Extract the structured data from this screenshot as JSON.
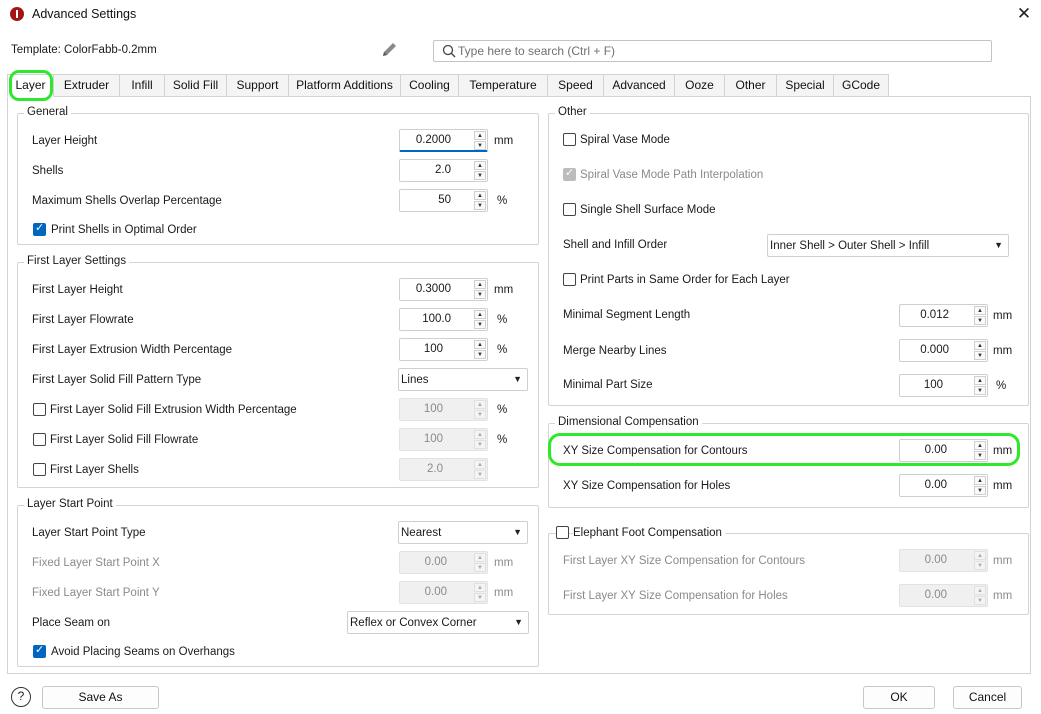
{
  "window": {
    "title": "Advanced Settings",
    "close_glyph": "✕"
  },
  "template": {
    "label": "Template: ColorFabb-0.2mm"
  },
  "search": {
    "placeholder": "Type here to search (Ctrl + F)"
  },
  "tabs": [
    "Layer",
    "Extruder",
    "Infill",
    "Solid Fill",
    "Support",
    "Platform Additions",
    "Cooling",
    "Temperature",
    "Speed",
    "Advanced",
    "Ooze",
    "Other",
    "Special",
    "GCode"
  ],
  "active_tab": "Layer",
  "general": {
    "title": "General",
    "layer_height": {
      "label": "Layer Height",
      "value": "0.2000",
      "unit": "mm"
    },
    "shells": {
      "label": "Shells",
      "value": "2.0"
    },
    "max_overlap": {
      "label": "Maximum Shells Overlap Percentage",
      "value": "50",
      "unit": "%"
    },
    "print_shells_optimal": {
      "label": "Print Shells in Optimal Order",
      "checked": true
    }
  },
  "first_layer": {
    "title": "First Layer Settings",
    "height": {
      "label": "First Layer Height",
      "value": "0.3000",
      "unit": "mm"
    },
    "flowrate": {
      "label": "First Layer Flowrate",
      "value": "100.0",
      "unit": "%"
    },
    "extrusion_width": {
      "label": "First Layer Extrusion Width Percentage",
      "value": "100",
      "unit": "%"
    },
    "solid_fill_pattern": {
      "label": "First Layer Solid Fill Pattern Type",
      "value": "Lines"
    },
    "solid_fill_extrusion_width": {
      "label": "First Layer Solid Fill Extrusion Width Percentage",
      "value": "100",
      "unit": "%",
      "checked": false
    },
    "solid_fill_flowrate": {
      "label": "First Layer Solid Fill Flowrate",
      "value": "100",
      "unit": "%",
      "checked": false
    },
    "shells": {
      "label": "First Layer Shells",
      "value": "2.0",
      "checked": false
    }
  },
  "start_point": {
    "title": "Layer Start Point",
    "type": {
      "label": "Layer Start Point Type",
      "value": "Nearest"
    },
    "fixed_x": {
      "label": "Fixed Layer Start Point X",
      "value": "0.00",
      "unit": "mm"
    },
    "fixed_y": {
      "label": "Fixed Layer Start Point Y",
      "value": "0.00",
      "unit": "mm"
    },
    "seam": {
      "label": "Place Seam on",
      "value": "Reflex or Convex Corner"
    },
    "avoid_seams": {
      "label": "Avoid Placing Seams on Overhangs",
      "checked": true
    }
  },
  "other": {
    "title": "Other",
    "spiral_vase": {
      "label": "Spiral Vase Mode",
      "checked": false
    },
    "spiral_interp": {
      "label": "Spiral Vase Mode Path Interpolation",
      "checked": true,
      "disabled": true
    },
    "single_shell": {
      "label": "Single Shell Surface Mode",
      "checked": false
    },
    "shell_infill_order": {
      "label": "Shell and Infill Order",
      "value": "Inner Shell > Outer Shell > Infill"
    },
    "same_order": {
      "label": "Print Parts in Same Order for Each Layer",
      "checked": false
    },
    "min_segment": {
      "label": "Minimal Segment Length",
      "value": "0.012",
      "unit": "mm"
    },
    "merge_lines": {
      "label": "Merge Nearby Lines",
      "value": "0.000",
      "unit": "mm"
    },
    "min_part": {
      "label": "Minimal Part Size",
      "value": "100",
      "unit": "%"
    }
  },
  "dimensional": {
    "title": "Dimensional Compensation",
    "xy_contours": {
      "label": "XY Size Compensation for Contours",
      "value": "0.00",
      "unit": "mm"
    },
    "xy_holes": {
      "label": "XY Size Compensation for Holes",
      "value": "0.00",
      "unit": "mm"
    }
  },
  "elephant": {
    "title": "Elephant Foot Compensation",
    "checked": false,
    "contours": {
      "label": "First Layer XY Size Compensation for Contours",
      "value": "0.00",
      "unit": "mm"
    },
    "holes": {
      "label": "First Layer XY Size Compensation for Holes",
      "value": "0.00",
      "unit": "mm"
    }
  },
  "footer": {
    "help": "?",
    "save_as": "Save As",
    "ok": "OK",
    "cancel": "Cancel"
  },
  "colors": {
    "highlight": "#2ee82e",
    "accent": "#0067c0",
    "app_icon": "#a31515"
  },
  "icons": [
    "app-icon",
    "pencil-icon",
    "search-icon",
    "close-icon",
    "help-icon",
    "chevron-down-icon",
    "spin-up-icon",
    "spin-down-icon"
  ]
}
